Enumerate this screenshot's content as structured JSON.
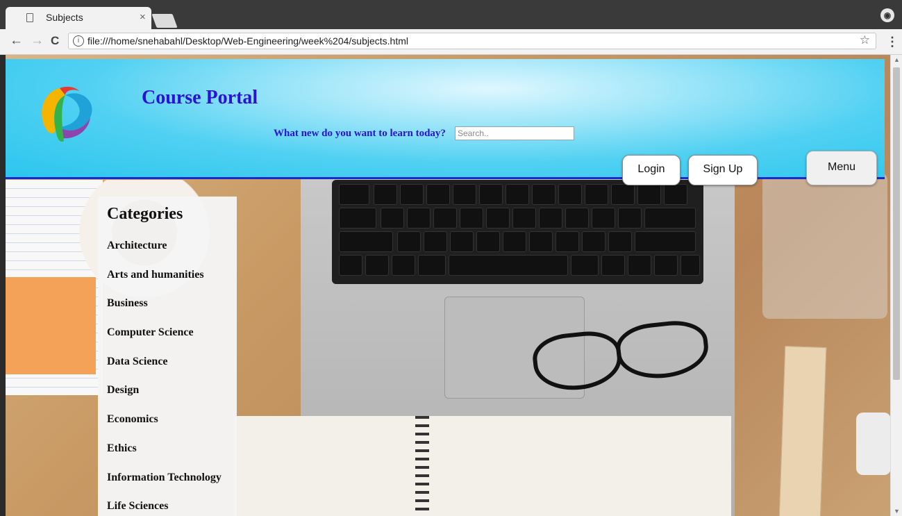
{
  "browser": {
    "tab_title": "Subjects",
    "tab_close": "×",
    "address": "file:///home/snehabahl/Desktop/Web-Engineering/week%204/subjects.html",
    "back": "←",
    "forward": "→",
    "reload": "C",
    "info": "i",
    "bookmark": "☆",
    "menu": "⋮",
    "profile": "👤"
  },
  "header": {
    "site_title": "Course Portal",
    "search_label": "What new do you want to learn today?",
    "search_placeholder": "Search..",
    "login_label": "Login",
    "signup_label": "Sign Up",
    "menu_label": "Menu"
  },
  "categories": {
    "heading": "Categories",
    "items": [
      "Architecture",
      "Arts and humanities",
      "Business",
      "Computer Science",
      "Data Science",
      "Design",
      "Economics",
      "Ethics",
      "Information Technology",
      "Life Sciences"
    ]
  },
  "colors": {
    "header_accent": "#2a12d6",
    "header_bg": "#2cc6ee",
    "header_border": "#1a29c9"
  }
}
